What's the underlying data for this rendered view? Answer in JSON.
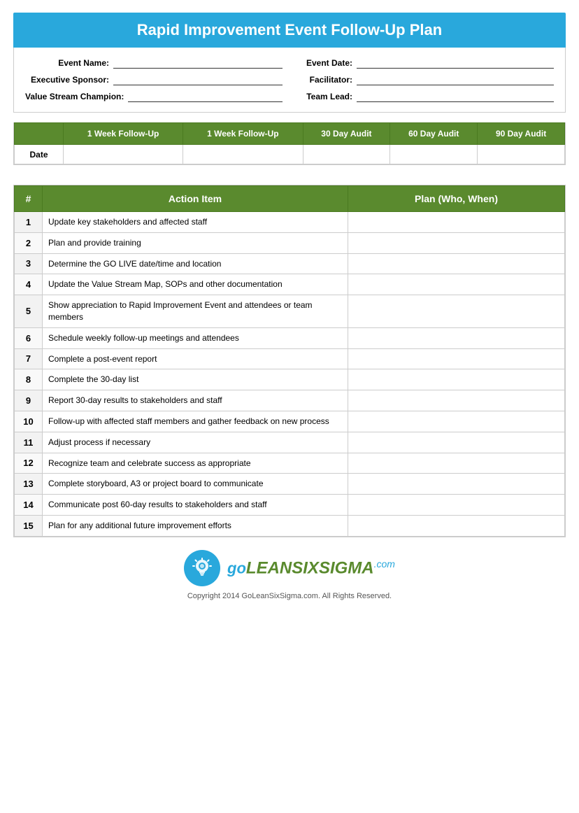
{
  "header": {
    "title": "Rapid Improvement Event Follow-Up Plan"
  },
  "form": {
    "left": [
      {
        "label": "Event Name:",
        "value": ""
      },
      {
        "label": "Executive Sponsor:",
        "value": ""
      },
      {
        "label": "Value Stream Champion:",
        "value": ""
      }
    ],
    "right": [
      {
        "label": "Event Date:",
        "value": ""
      },
      {
        "label": "Facilitator:",
        "value": ""
      },
      {
        "label": "Team Lead:",
        "value": ""
      }
    ]
  },
  "audit_table": {
    "columns": [
      {
        "label": ""
      },
      {
        "label": "1 Week Follow-Up"
      },
      {
        "label": "1 Week Follow-Up"
      },
      {
        "label": "30 Day Audit"
      },
      {
        "label": "60 Day Audit"
      },
      {
        "label": "90 Day Audit"
      }
    ],
    "date_label": "Date"
  },
  "action_table": {
    "headers": [
      "#",
      "Action Item",
      "Plan (Who, When)"
    ],
    "rows": [
      {
        "num": "1",
        "action": "Update key stakeholders and affected staff"
      },
      {
        "num": "2",
        "action": "Plan and provide training"
      },
      {
        "num": "3",
        "action": "Determine the GO LIVE date/time and location"
      },
      {
        "num": "4",
        "action": "Update the Value Stream Map, SOPs and other documentation"
      },
      {
        "num": "5",
        "action": "Show appreciation to Rapid Improvement Event and attendees or team members"
      },
      {
        "num": "6",
        "action": "Schedule weekly follow-up meetings and attendees"
      },
      {
        "num": "7",
        "action": "Complete a post-event report"
      },
      {
        "num": "8",
        "action": "Complete the 30-day list"
      },
      {
        "num": "9",
        "action": "Report 30-day results to stakeholders and staff"
      },
      {
        "num": "10",
        "action": "Follow-up with affected staff members and gather feedback on new process"
      },
      {
        "num": "11",
        "action": "Adjust process if necessary"
      },
      {
        "num": "12",
        "action": "Recognize team and celebrate success as appropriate"
      },
      {
        "num": "13",
        "action": "Complete storyboard, A3 or project board to communicate"
      },
      {
        "num": "14",
        "action": "Communicate post 60-day results to stakeholders and staff"
      },
      {
        "num": "15",
        "action": "Plan for any additional future improvement efforts"
      }
    ]
  },
  "footer": {
    "logo_go": "go",
    "logo_main": "LEANSIXSIGMA",
    "logo_dotcom": ".com",
    "copyright": "Copyright 2014 GoLeanSixSigma.com. All Rights Reserved."
  }
}
